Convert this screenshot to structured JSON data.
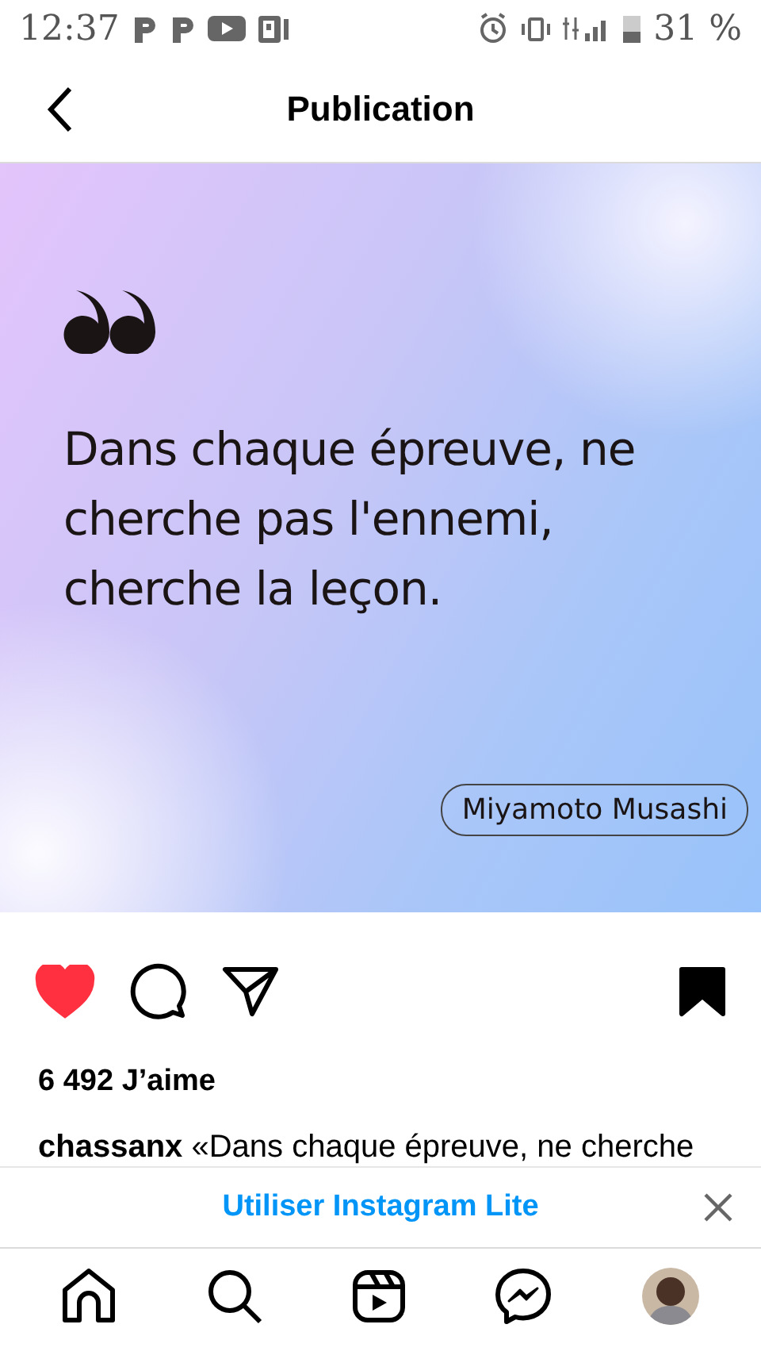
{
  "status_bar": {
    "time": "12:37",
    "battery": "31 %"
  },
  "header": {
    "title": "Publication"
  },
  "post": {
    "quote": "Dans chaque épreuve, ne cherche pas l'ennemi, cherche la leçon.",
    "author": "Miyamoto Musashi"
  },
  "actions": {
    "liked": true,
    "saved": true
  },
  "likes": "6 492 J’aime",
  "caption": {
    "user": "chassanx",
    "text": "«Dans chaque épreuve, ne cherche"
  },
  "banner": {
    "label": "Utiliser Instagram Lite"
  },
  "nav": [
    {
      "kind": "home",
      "selected": false
    },
    {
      "kind": "search",
      "selected": false
    },
    {
      "kind": "reels",
      "selected": false
    },
    {
      "kind": "messenger",
      "selected": false
    },
    {
      "kind": "profile",
      "selected": false
    }
  ]
}
